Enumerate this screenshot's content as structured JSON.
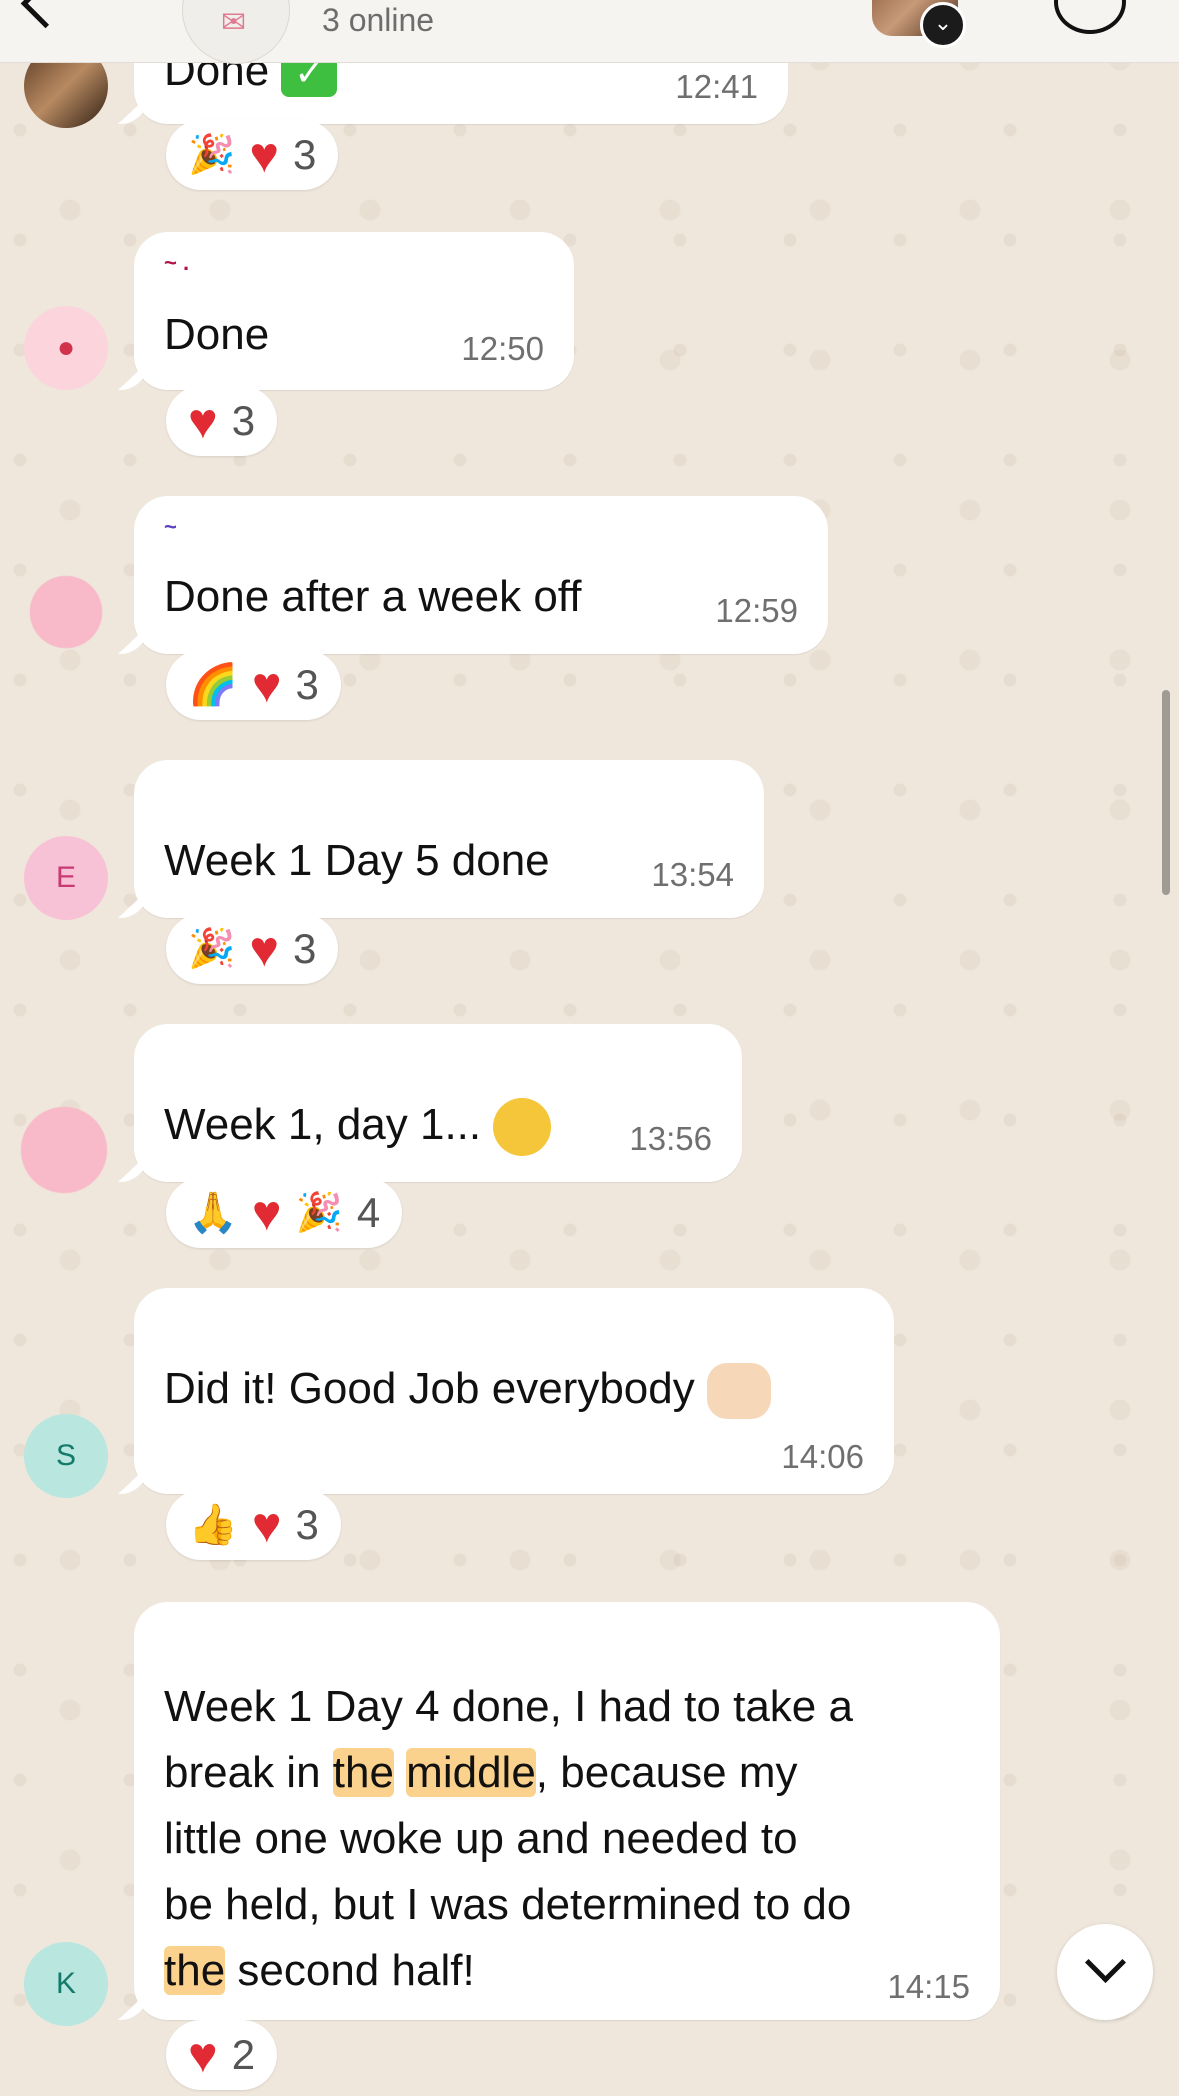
{
  "header": {
    "subtitle": "3 online",
    "group_icon": "group-chat-icon",
    "back_icon": "back-chevron-icon",
    "right_icon": "call-icon",
    "badge_icon": "chevron-down-icon"
  },
  "messages": [
    {
      "avatar_type": "photo",
      "sender_mark": "",
      "text": "Done",
      "text_emoji": "check-mark-button-icon",
      "time": "12:41",
      "reactions": [
        "party-popper",
        "heart"
      ],
      "reaction_count": "3"
    },
    {
      "avatar_type": "person",
      "sender_mark": "~ .",
      "text": "Done",
      "time": "12:50",
      "reactions": [
        "heart"
      ],
      "reaction_count": "3"
    },
    {
      "avatar_type": "blurred",
      "sender_mark": "~",
      "text": "Done after a week off",
      "time": "12:59",
      "reactions": [
        "rainbow",
        "heart"
      ],
      "reaction_count": "3"
    },
    {
      "avatar_type": "letter",
      "avatar_letter": "E",
      "sender_mark": "",
      "text": "Week 1 Day 5 done",
      "time": "13:54",
      "reactions": [
        "party-popper",
        "heart"
      ],
      "reaction_count": "3"
    },
    {
      "avatar_type": "blurred",
      "sender_mark": "",
      "text": "Week 1, day 1...",
      "time": "13:56",
      "reactions": [
        "folded-hands",
        "heart",
        "party-popper"
      ],
      "reaction_count": "4"
    },
    {
      "avatar_type": "letter",
      "avatar_letter": "S",
      "sender_mark": "",
      "text": "Did it! Good Job everybody",
      "time": "14:06",
      "reactions": [
        "thumbs-up",
        "heart"
      ],
      "reaction_count": "3"
    },
    {
      "avatar_type": "letter",
      "avatar_letter": "K",
      "sender_mark": "",
      "text_lines": [
        "Week 1 Day 4 done, I had to take a",
        "break in the middle, because my",
        "little one woke up and needed to",
        "be held, but I was determined to do",
        "the second half!"
      ],
      "time": "14:15",
      "reactions": [
        "heart"
      ],
      "reaction_count": "2"
    }
  ],
  "scroll_button_icon": "chevron-down-icon",
  "colors": {
    "highlight": "#fbd28d",
    "bubble": "#ffffff",
    "wallpaper": "#efe7dc",
    "heart": "#e12a33"
  }
}
